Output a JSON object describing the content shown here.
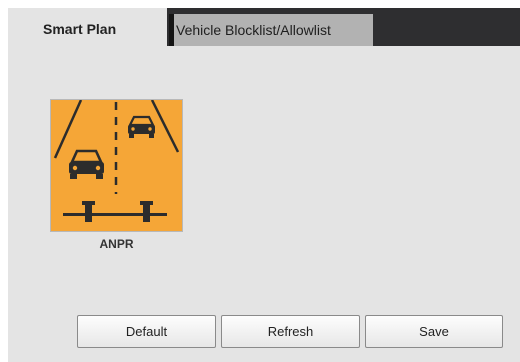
{
  "tabs": [
    {
      "label": "Smart Plan",
      "active": true
    },
    {
      "label": "Vehicle Blocklist/Allowlist",
      "active": false
    }
  ],
  "plan_tiles": [
    {
      "label": "ANPR",
      "icon": "anpr-road-vehicles-icon"
    }
  ],
  "buttons": {
    "default_label": "Default",
    "refresh_label": "Refresh",
    "save_label": "Save"
  },
  "colors": {
    "tab_bar": "#2e2e30",
    "panel": "#e4e4e4",
    "tile_orange": "#f5a637"
  }
}
